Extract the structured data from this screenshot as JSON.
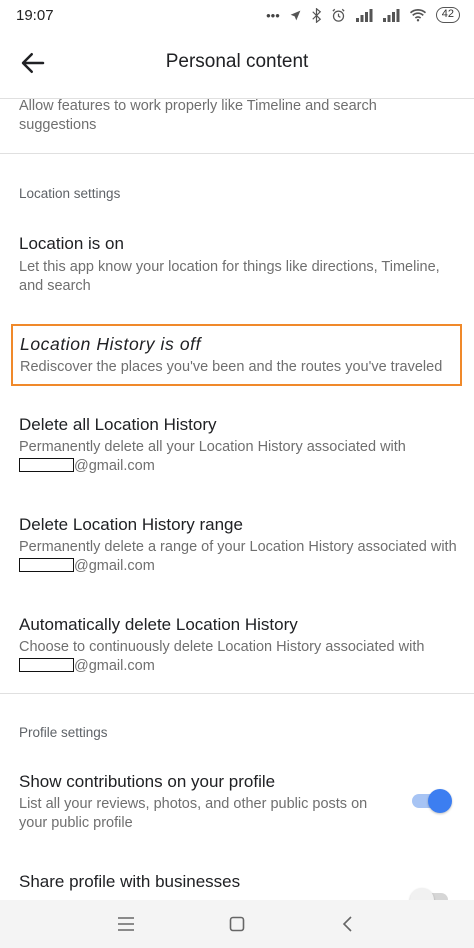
{
  "status_bar": {
    "time": "19:07",
    "battery_level": "42",
    "icons": [
      "alarm-indicator-icon",
      "location-arrow-icon",
      "bluetooth-icon",
      "alarm-clock-icon",
      "signal-icon",
      "signal-icon-2",
      "wifi-icon",
      "battery-icon"
    ]
  },
  "app_bar": {
    "title": "Personal content",
    "back_icon": "arrow-back-icon"
  },
  "partial_item": {
    "desc": "Allow features to work properly like Timeline and search suggestions"
  },
  "location_settings": {
    "header": "Location settings",
    "items": [
      {
        "title": "Location is on",
        "desc": "Let this app know your location for things like directions, Timeline, and search"
      },
      {
        "title": "Location History is off",
        "desc": "Rediscover the places you've been and the routes you've traveled",
        "highlighted": true
      },
      {
        "title": "Delete all Location History",
        "desc_prefix": "Permanently delete all your Location History associated with",
        "email_suffix": "@gmail.com"
      },
      {
        "title": "Delete Location History range",
        "desc_prefix": "Permanently delete a range of your Location History associated with",
        "email_suffix": "@gmail.com"
      },
      {
        "title": "Automatically delete Location History",
        "desc_prefix": "Choose to continuously delete Location History associated with",
        "email_suffix": "@gmail.com"
      }
    ]
  },
  "profile_settings": {
    "header": "Profile settings",
    "items": [
      {
        "title": "Show contributions on your profile",
        "desc": "List all your reviews, photos, and other public posts on your public profile",
        "toggle": true
      },
      {
        "title": "Share profile with businesses",
        "toggle": false
      }
    ]
  },
  "colors": {
    "accent": "#3c7ef1",
    "highlight_border": "#f0892a",
    "secondary_text": "#6f6f6f"
  },
  "nav_bar": {
    "icons": [
      "menu-icon",
      "home-square-icon",
      "back-chevron-icon"
    ]
  }
}
